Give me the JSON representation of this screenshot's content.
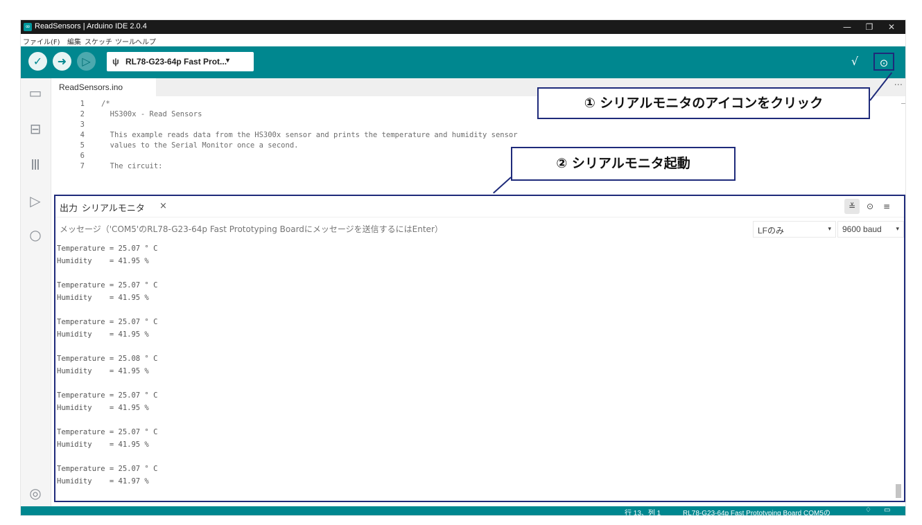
{
  "window": {
    "title": "ReadSensors | Arduino IDE 2.0.4",
    "app_icon": "∞",
    "min_icon": "—",
    "max_icon": "❐",
    "close_icon": "✕"
  },
  "menu": [
    "ファイル(F)",
    "編集",
    "スケッチ",
    "ツール",
    "ヘルプ"
  ],
  "toolbar": {
    "verify_icon": "✓",
    "upload_icon": "➜",
    "debug_icon": "▷",
    "usb_icon": "ψ",
    "board_label": "RL78-G23-64p Fast Prot...",
    "board_caret": "▾",
    "plotter_icon": "√",
    "monitor_icon": "⊙"
  },
  "sidebar": {
    "icons": [
      "folder-icon",
      "board-icon",
      "library-icon",
      "debug-icon",
      "search-icon",
      "profile-icon"
    ],
    "glyphs": [
      "▭",
      "⊟",
      "Ⅲ",
      "▷",
      "○",
      "◎"
    ]
  },
  "editor": {
    "tab_label": "ReadSensors.ino",
    "tab_more": "···",
    "lines": [
      {
        "n": "1",
        "text": "/*"
      },
      {
        "n": "2",
        "text": "  HS300x - Read Sensors"
      },
      {
        "n": "3",
        "text": ""
      },
      {
        "n": "4",
        "text": "  This example reads data from the HS300x sensor and prints the temperature and humidity sensor"
      },
      {
        "n": "5",
        "text": "  values to the Serial Monitor once a second."
      },
      {
        "n": "6",
        "text": ""
      },
      {
        "n": "7",
        "text": "  The circuit:"
      }
    ]
  },
  "callouts": {
    "step1": "① シリアルモニタのアイコンをクリック",
    "step2": "② シリアルモニタ起動"
  },
  "serial_monitor": {
    "tab_output": "出力",
    "tab_monitor": "シリアルモニタ",
    "tab_close": "×",
    "collapse_icon": "≚",
    "timestamp_icon": "⊙",
    "clear_icon": "≡",
    "message_placeholder": "メッセージ（'COM5'のRL78-G23-64p Fast Prototyping Boardにメッセージを送信するにはEnter）",
    "line_ending": "LFのみ",
    "baud_rate": "9600 baud",
    "caret": "▾",
    "readings": [
      {
        "temperature": "Temperature = 25.07 ° C",
        "humidity": "Humidity    = 41.95 %"
      },
      {
        "temperature": "Temperature = 25.07 ° C",
        "humidity": "Humidity    = 41.95 %"
      },
      {
        "temperature": "Temperature = 25.07 ° C",
        "humidity": "Humidity    = 41.95 %"
      },
      {
        "temperature": "Temperature = 25.08 ° C",
        "humidity": "Humidity    = 41.95 %"
      },
      {
        "temperature": "Temperature = 25.07 ° C",
        "humidity": "Humidity    = 41.95 %"
      },
      {
        "temperature": "Temperature = 25.07 ° C",
        "humidity": "Humidity    = 41.95 %"
      },
      {
        "temperature": "Temperature = 25.07 ° C",
        "humidity": "Humidity    = 41.97 %"
      }
    ]
  },
  "statusbar": {
    "cursor_position": "行 13、列 1",
    "board_port": "RL78-G23-64p Fast Prototyping Board COM5の",
    "bell_icon": "♢",
    "panel_icon": "▭"
  }
}
